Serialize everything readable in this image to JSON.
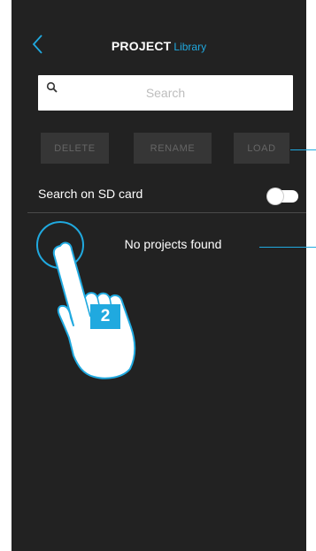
{
  "header": {
    "title_strong": "PROJECT",
    "title_accent": "Library",
    "back_icon": "chevron-left-icon"
  },
  "search": {
    "placeholder": "Search",
    "icon": "search-icon"
  },
  "actions": {
    "delete_label": "DELETE",
    "rename_label": "RENAME",
    "load_label": "LOAD"
  },
  "sd_search": {
    "label": "Search on SD card",
    "enabled": false
  },
  "results": {
    "empty_message": "No projects found"
  },
  "annotation": {
    "step_number": "2",
    "accent_color": "#20a9df"
  }
}
